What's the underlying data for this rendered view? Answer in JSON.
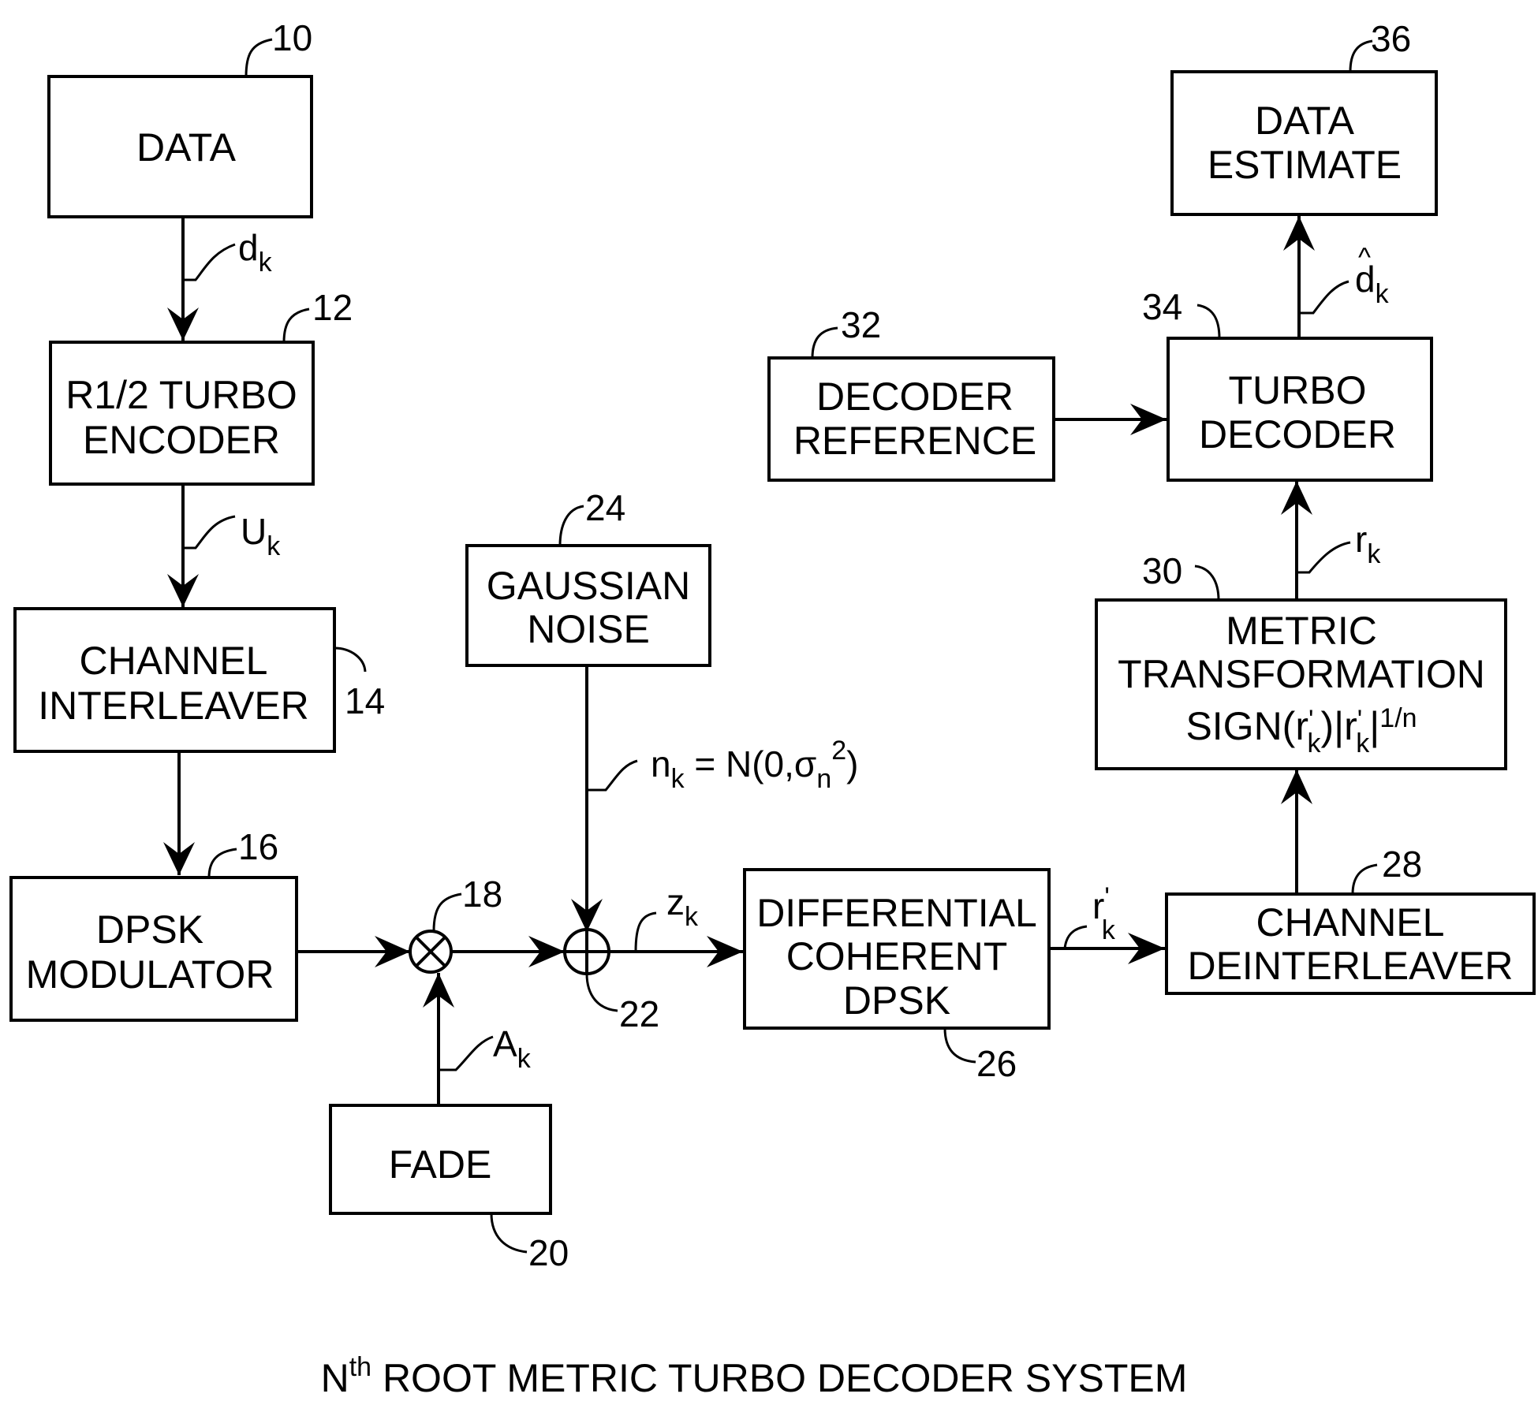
{
  "title": {
    "prefix": "N",
    "sup": "th",
    "rest": " ROOT METRIC TURBO DECODER SYSTEM"
  },
  "blocks": {
    "data": {
      "ref": "10",
      "lines": [
        "DATA"
      ]
    },
    "encoder": {
      "ref": "12",
      "lines": [
        "R1/2 TURBO",
        "ENCODER"
      ]
    },
    "interleaver": {
      "ref": "14",
      "lines": [
        "CHANNEL",
        "INTERLEAVER"
      ]
    },
    "modulator": {
      "ref": "16",
      "lines": [
        "DPSK",
        "MODULATOR"
      ]
    },
    "multiplier": {
      "ref": "18",
      "symbol": "⊗"
    },
    "fade": {
      "ref": "20",
      "lines": [
        "FADE"
      ]
    },
    "adder": {
      "ref": "22",
      "symbol": "⊕"
    },
    "noise": {
      "ref": "24",
      "lines": [
        "GAUSSIAN",
        "NOISE"
      ]
    },
    "demod": {
      "ref": "26",
      "lines": [
        "DIFFERENTIAL",
        "COHERENT",
        "DPSK"
      ]
    },
    "deinterleaver": {
      "ref": "28",
      "lines": [
        "CHANNEL",
        "DEINTERLEAVER"
      ]
    },
    "metric": {
      "ref": "30",
      "lines": [
        "METRIC",
        "TRANSFORMATION"
      ],
      "formula": {
        "a": "SIGN(r",
        "a_sup": "'",
        "a_sub": "k",
        "b": ")|r",
        "b_sup": "'",
        "b_sub": "k",
        "c": "|",
        "c_sup": "1/n"
      }
    },
    "decoder_ref": {
      "ref": "32",
      "lines": [
        "DECODER",
        "REFERENCE"
      ]
    },
    "turbo_decoder": {
      "ref": "34",
      "lines": [
        "TURBO",
        "DECODER"
      ]
    },
    "data_estimate": {
      "ref": "36",
      "lines": [
        "DATA",
        "ESTIMATE"
      ]
    }
  },
  "signals": {
    "dk": {
      "base": "d",
      "sub": "k"
    },
    "uk": {
      "base": "U",
      "sub": "k"
    },
    "ak": {
      "base": "A",
      "sub": "k"
    },
    "nk": {
      "base": "n",
      "sub": "k",
      "rest": " = N(0,σ",
      "sub2": "n",
      "sup2": "2",
      "end": ")"
    },
    "zk": {
      "base": "z",
      "sub": "k"
    },
    "rk_prime": {
      "base": "r",
      "sup": "'",
      "sub": "k"
    },
    "rk": {
      "base": "r",
      "sub": "k"
    },
    "dk_hat": {
      "hat": "^",
      "base": "d",
      "sub": "k"
    }
  }
}
